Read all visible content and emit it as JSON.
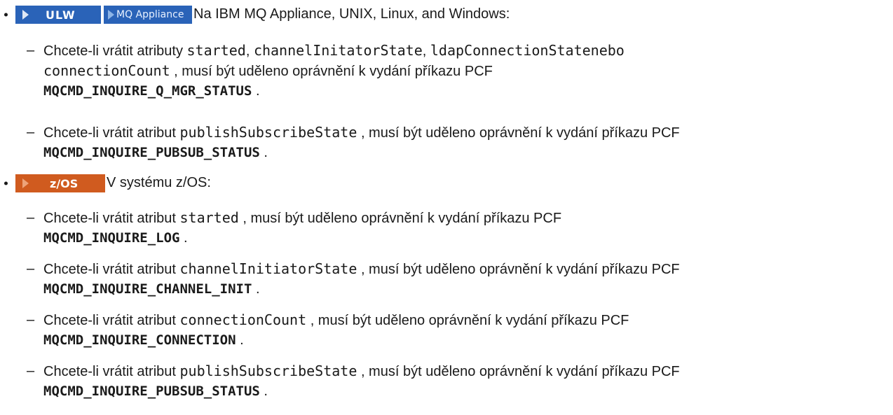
{
  "sections": [
    {
      "badges": [
        "ULW",
        "MQ Appliance"
      ],
      "heading": "Na IBM MQ Appliance, UNIX, Linux, and Windows:",
      "items": [
        {
          "prefix": "Chcete-li vrátit atributy ",
          "attrs": [
            "started",
            "channelInitatorState",
            "ldapConnectionStatenebo",
            "connectionCount"
          ],
          "seps": [
            ", ",
            ", ",
            " "
          ],
          "suffix": " , musí být uděleno oprávnění k vydání příkazu PCF",
          "command": "MQCMD_INQUIRE_Q_MGR_STATUS",
          "end": " ."
        },
        {
          "prefix": "Chcete-li vrátit atribut ",
          "attrs": [
            "publishSubscribeState"
          ],
          "suffix": " , musí být uděleno oprávnění k vydání příkazu PCF",
          "command": "MQCMD_INQUIRE_PUBSUB_STATUS",
          "end": " ."
        }
      ]
    },
    {
      "badges": [
        "z/OS"
      ],
      "heading": "V systému z/OS:",
      "items": [
        {
          "prefix": "Chcete-li vrátit atribut ",
          "attrs": [
            "started"
          ],
          "suffix": " , musí být uděleno oprávnění k vydání příkazu PCF",
          "command": "MQCMD_INQUIRE_LOG",
          "end": " ."
        },
        {
          "prefix": "Chcete-li vrátit atribut ",
          "attrs": [
            "channelInitiatorState"
          ],
          "suffix": " , musí být uděleno oprávnění k vydání příkazu PCF",
          "command": "MQCMD_INQUIRE_CHANNEL_INIT",
          "end": " ."
        },
        {
          "prefix": "Chcete-li vrátit atribut ",
          "attrs": [
            "connectionCount"
          ],
          "suffix": " , musí být uděleno oprávnění k vydání příkazu PCF",
          "command": "MQCMD_INQUIRE_CONNECTION",
          "end": " ."
        },
        {
          "prefix": "Chcete-li vrátit atribut ",
          "attrs": [
            "publishSubscribeState"
          ],
          "suffix": " , musí být uděleno oprávnění k vydání příkazu PCF",
          "command": "MQCMD_INQUIRE_PUBSUB_STATUS",
          "end": " ."
        }
      ]
    }
  ],
  "dash_glyph": "–",
  "colors": {
    "badge_blue": "#2a63b8",
    "badge_orange": "#d05b1f",
    "text": "#1a1a1a"
  }
}
